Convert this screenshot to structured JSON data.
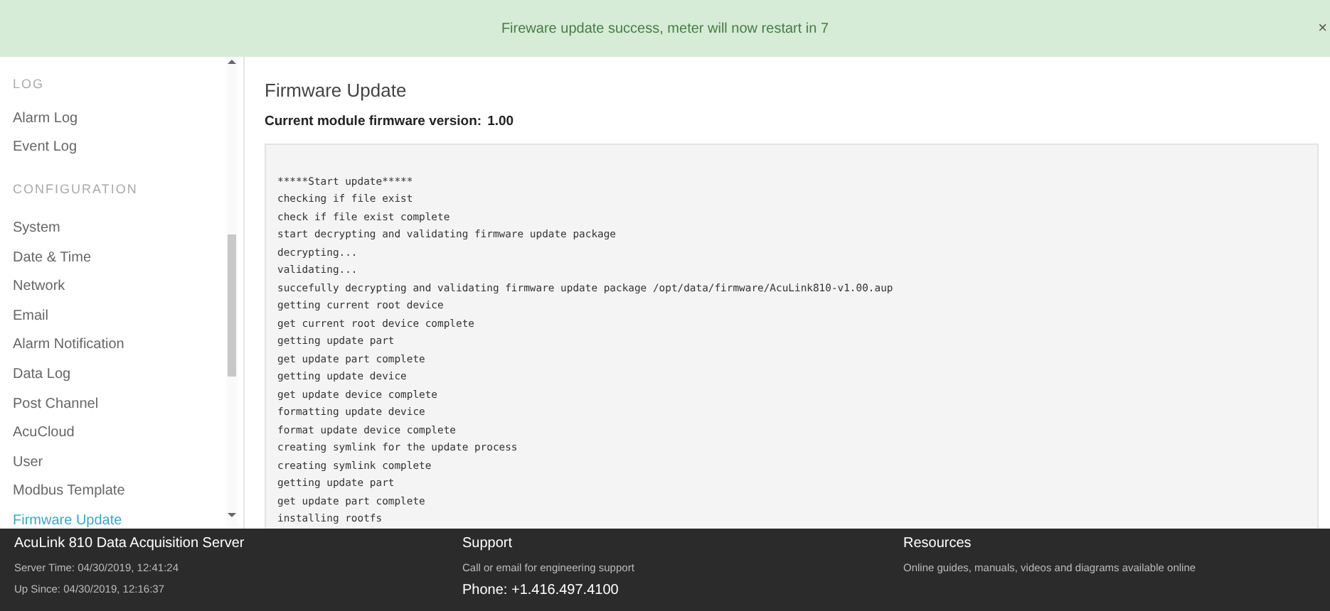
{
  "banner": {
    "message": "Fireware update success, meter will now restart in 7",
    "close": "×"
  },
  "sidebar": {
    "sections": [
      {
        "heading": "LOG",
        "items": [
          {
            "label": "Alarm Log",
            "selected": false
          },
          {
            "label": "Event Log",
            "selected": false
          }
        ]
      },
      {
        "heading": "CONFIGURATION",
        "items": [
          {
            "label": "System",
            "selected": false
          },
          {
            "label": "Date & Time",
            "selected": false
          },
          {
            "label": "Network",
            "selected": false
          },
          {
            "label": "Email",
            "selected": false
          },
          {
            "label": "Alarm Notification",
            "selected": false
          },
          {
            "label": "Data Log",
            "selected": false
          },
          {
            "label": "Post Channel",
            "selected": false
          },
          {
            "label": "AcuCloud",
            "selected": false
          },
          {
            "label": "User",
            "selected": false
          },
          {
            "label": "Modbus Template",
            "selected": false
          },
          {
            "label": "Firmware Update",
            "selected": true
          }
        ]
      }
    ]
  },
  "main": {
    "title": "Firmware Update",
    "version_label": "Current module firmware version:",
    "version_value": "1.00",
    "log_lines": [
      "*****Start update*****",
      "checking if file exist",
      "check if file exist complete",
      "start decrypting and validating firmware update package",
      "decrypting...",
      "validating...",
      "succefully decrypting and validating firmware update package /opt/data/firmware/AcuLink810-v1.00.aup",
      "getting current root device",
      "get current root device complete",
      "getting update part",
      "get update part complete",
      "getting update device",
      "get update device complete",
      "formatting update device",
      "format update device complete",
      "creating symlink for the update process",
      "creating symlink complete",
      "getting update part",
      "get update part complete",
      "installing rootfs"
    ]
  },
  "footer": {
    "columns": [
      {
        "title": "AcuLink 810 Data Acquisition Server",
        "lines": [
          "Server Time: 04/30/2019, 12:41:24",
          "Up Since: 04/30/2019, 12:16:37"
        ]
      },
      {
        "title": "Support",
        "lines": [
          "Call or email for engineering support",
          "Phone: +1.416.497.4100"
        ]
      },
      {
        "title": "Resources",
        "lines": [
          "Online guides, manuals, videos and diagrams available online"
        ]
      }
    ]
  }
}
